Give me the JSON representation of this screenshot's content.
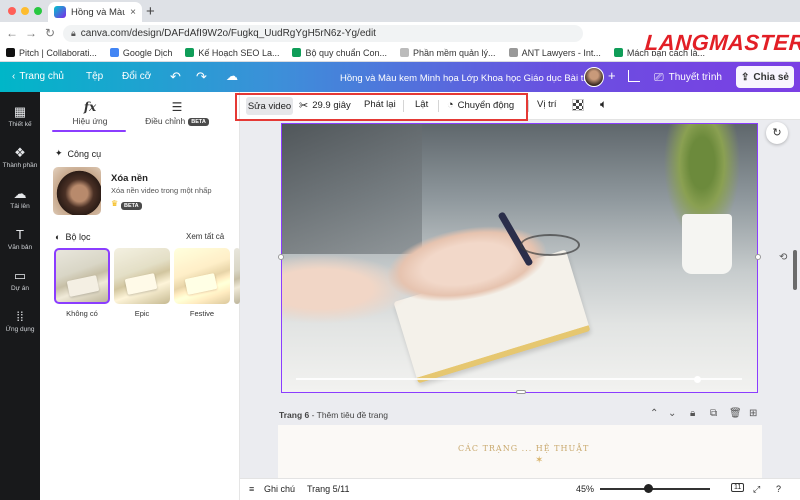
{
  "browser": {
    "tab_title": "Hồng và Màu kem Minh họa Lớ",
    "tab_close": "×",
    "new_tab": "+",
    "url": "canva.com/design/DAFdAfI9W2o/Fugkq_UudRgYgH5rN6z-Yg/edit",
    "bookmarks": [
      {
        "label": "Pitch | Collaborati...",
        "color": "#111111"
      },
      {
        "label": "Google Dịch",
        "color": "#4285f4"
      },
      {
        "label": "Kế Hoạch SEO La...",
        "color": "#0f9d58"
      },
      {
        "label": "Bộ quy chuẩn Con...",
        "color": "#0f9d58"
      },
      {
        "label": "Phần mềm quản lý...",
        "color": "#bbbbbb"
      },
      {
        "label": "ANT Lawyers - Int...",
        "color": "#999999"
      },
      {
        "label": "Mách bạn cách là...",
        "color": "#0f9d58"
      }
    ]
  },
  "watermark": "LANGMASTER",
  "canva_header": {
    "home": "Trang chủ",
    "file": "Tệp",
    "resize": "Đổi cỡ",
    "doc_title": "Hồng và Màu kem Minh họa Lớp Khoa học Giáo dục Bài thu...",
    "add_user": "+",
    "present": "Thuyết trình",
    "share": "Chia sẻ",
    "gradient_start": "#00b6c8",
    "gradient_end": "#7b3fe4"
  },
  "left_rail": [
    {
      "icon": "layout-icon",
      "label": "Thiết kế"
    },
    {
      "icon": "elements-icon",
      "label": "Thành phần"
    },
    {
      "icon": "upload-icon",
      "label": "Tải lên"
    },
    {
      "icon": "text-icon",
      "label": "Văn bản"
    },
    {
      "icon": "folder-icon",
      "label": "Dự án"
    },
    {
      "icon": "apps-icon",
      "label": "Ứng dụng"
    }
  ],
  "side_panel": {
    "tab_effects": "Hiệu ứng",
    "tab_adjust": "Điều chỉnh",
    "beta": "BETA",
    "tools_title": "Công cụ",
    "remove_bg_title": "Xóa nền",
    "remove_bg_desc": "Xóa nền video trong một nhấp",
    "filters_title": "Bộ lọc",
    "see_all": "Xem tất cả",
    "filters": [
      "Không có",
      "Epic",
      "Festive"
    ]
  },
  "toolbar": {
    "edit_video": "Sửa video",
    "duration": "29.9 giây",
    "playback": "Phát lại",
    "flip": "Lật",
    "animate": "Chuyển động",
    "position": "Vị trí",
    "highlight_color": "#e53935"
  },
  "page": {
    "label_prefix": "Trang 6",
    "label_suffix": " - Thêm tiêu đề trang",
    "next_page_text": "CÁC TRẠNG ... HỆ THUẬT"
  },
  "bottom_bar": {
    "notes": "Ghi chú",
    "page_counter": "Trang 5/11",
    "zoom": "45%",
    "page_count_icon": "11"
  },
  "accent": "#8b3dff"
}
